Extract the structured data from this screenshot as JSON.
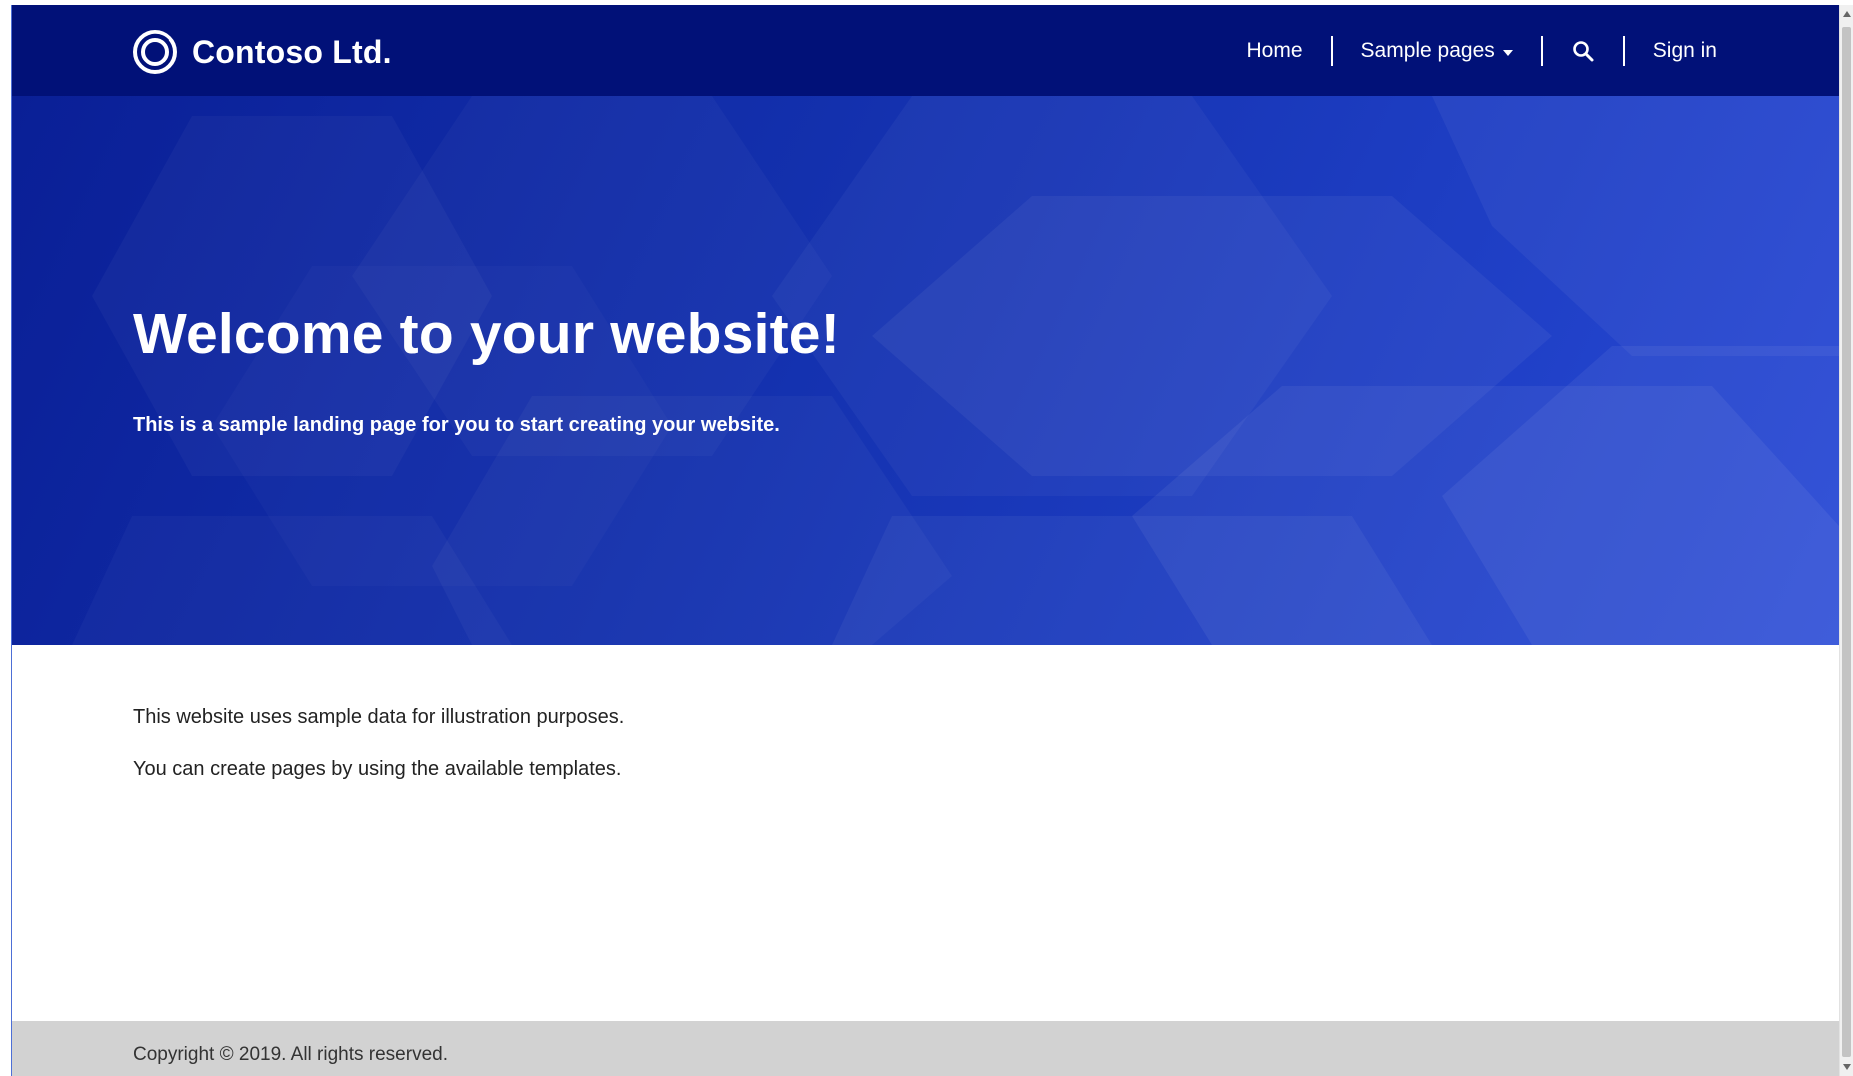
{
  "header": {
    "brand_name": "Contoso Ltd.",
    "logo_icon": "contoso-ring-logo-icon",
    "nav": {
      "home": "Home",
      "sample_pages": "Sample pages",
      "sign_in": "Sign in"
    },
    "search_icon": "search-icon",
    "caret_icon": "caret-down-icon"
  },
  "hero": {
    "title": "Welcome to your website!",
    "subtitle": "This is a sample landing page for you to start creating your website."
  },
  "main": {
    "paragraphs": [
      "This website uses sample data for illustration purposes.",
      "You can create pages by using the available templates."
    ]
  },
  "footer": {
    "copyright": "Copyright © 2019. All rights reserved."
  },
  "colors": {
    "header_bg": "#011178",
    "hero_bg_dark": "#0a1f96",
    "hero_bg_light": "#2849d6",
    "footer_bg": "#d2d2d2",
    "text_dark": "#222222",
    "text_light": "#ffffff"
  }
}
